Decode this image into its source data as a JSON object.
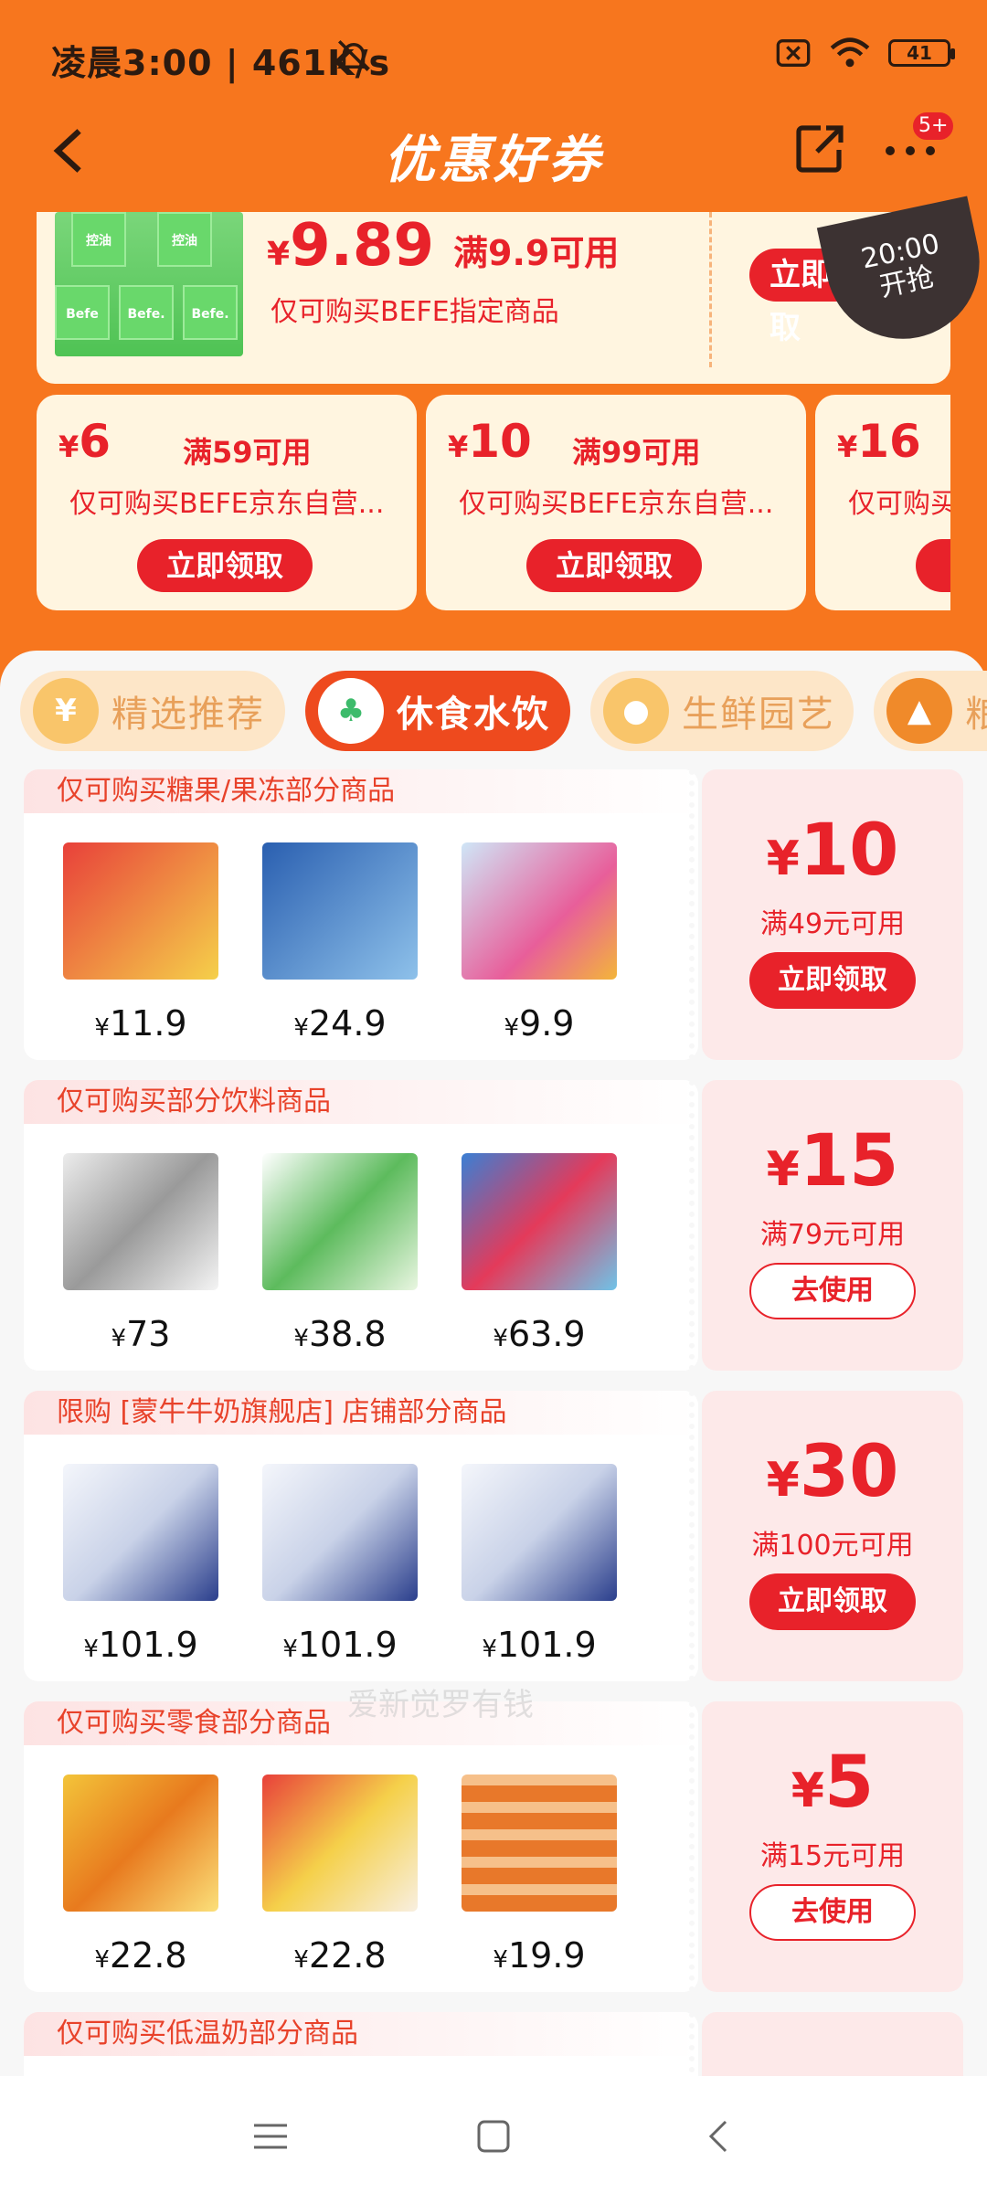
{
  "status": {
    "time": "凌晨3:00 | 461K/s",
    "battery": "41"
  },
  "header": {
    "title": "优惠好券",
    "badge": "5+"
  },
  "top_coupon": {
    "currency": "¥",
    "amount": "9.89",
    "condition": "满9.9可用",
    "desc": "仅可购买BEFE指定商品",
    "button": "立即领取",
    "timer_time": "20:00",
    "timer_label": "开抢",
    "packet_labels": [
      "控油",
      "控油",
      "Befe.",
      "Befe",
      "Befe."
    ]
  },
  "small_coupons": [
    {
      "currency": "¥",
      "amount": "6",
      "condition": "满59可用",
      "desc": "仅可购买BEFE京东自营...",
      "button": "立即领取"
    },
    {
      "currency": "¥",
      "amount": "10",
      "condition": "满99可用",
      "desc": "仅可购买BEFE京东自营...",
      "button": "立即领取"
    },
    {
      "currency": "¥",
      "amount": "16",
      "condition": "",
      "desc": "仅可购买",
      "button": "立"
    }
  ],
  "tabs": [
    {
      "label": "精选推荐",
      "icon": "¥",
      "active": false
    },
    {
      "label": "休食水饮",
      "icon": "♣",
      "active": true
    },
    {
      "label": "生鲜园艺",
      "icon": "●",
      "active": false
    },
    {
      "label": "粮",
      "icon": "▲",
      "active": false
    }
  ],
  "coupons": [
    {
      "scope": "仅可购买糖果/果冻部分商品",
      "currency": "¥",
      "amount": "10",
      "min_spend": "满49元可用",
      "button": "立即领取",
      "button_type": "claim",
      "products": [
        {
          "currency": "¥",
          "price": "11.9"
        },
        {
          "currency": "¥",
          "price": "24.9"
        },
        {
          "currency": "¥",
          "price": "9.9"
        }
      ]
    },
    {
      "scope": "仅可购买部分饮料商品",
      "currency": "¥",
      "amount": "15",
      "min_spend": "满79元可用",
      "button": "去使用",
      "button_type": "use",
      "products": [
        {
          "currency": "¥",
          "price": "73"
        },
        {
          "currency": "¥",
          "price": "38.8"
        },
        {
          "currency": "¥",
          "price": "63.9"
        }
      ]
    },
    {
      "scope": "限购 [蒙牛牛奶旗舰店] 店铺部分商品",
      "currency": "¥",
      "amount": "30",
      "min_spend": "满100元可用",
      "button": "立即领取",
      "button_type": "claim",
      "products": [
        {
          "currency": "¥",
          "price": "101.9"
        },
        {
          "currency": "¥",
          "price": "101.9"
        },
        {
          "currency": "¥",
          "price": "101.9"
        }
      ]
    },
    {
      "scope": "仅可购买零食部分商品",
      "currency": "¥",
      "amount": "5",
      "min_spend": "满15元可用",
      "button": "去使用",
      "button_type": "use",
      "products": [
        {
          "currency": "¥",
          "price": "22.8"
        },
        {
          "currency": "¥",
          "price": "22.8"
        },
        {
          "currency": "¥",
          "price": "19.9"
        }
      ]
    },
    {
      "scope": "仅可购买低温奶部分商品",
      "currency": "",
      "amount": "",
      "min_spend": "",
      "button": "",
      "button_type": "claim",
      "products": []
    }
  ],
  "watermark": "爱新觉罗有钱",
  "colors": {
    "brand_orange": "#f7761e",
    "accent_red": "#e8222a",
    "coupon_pink": "#fde9e9"
  }
}
